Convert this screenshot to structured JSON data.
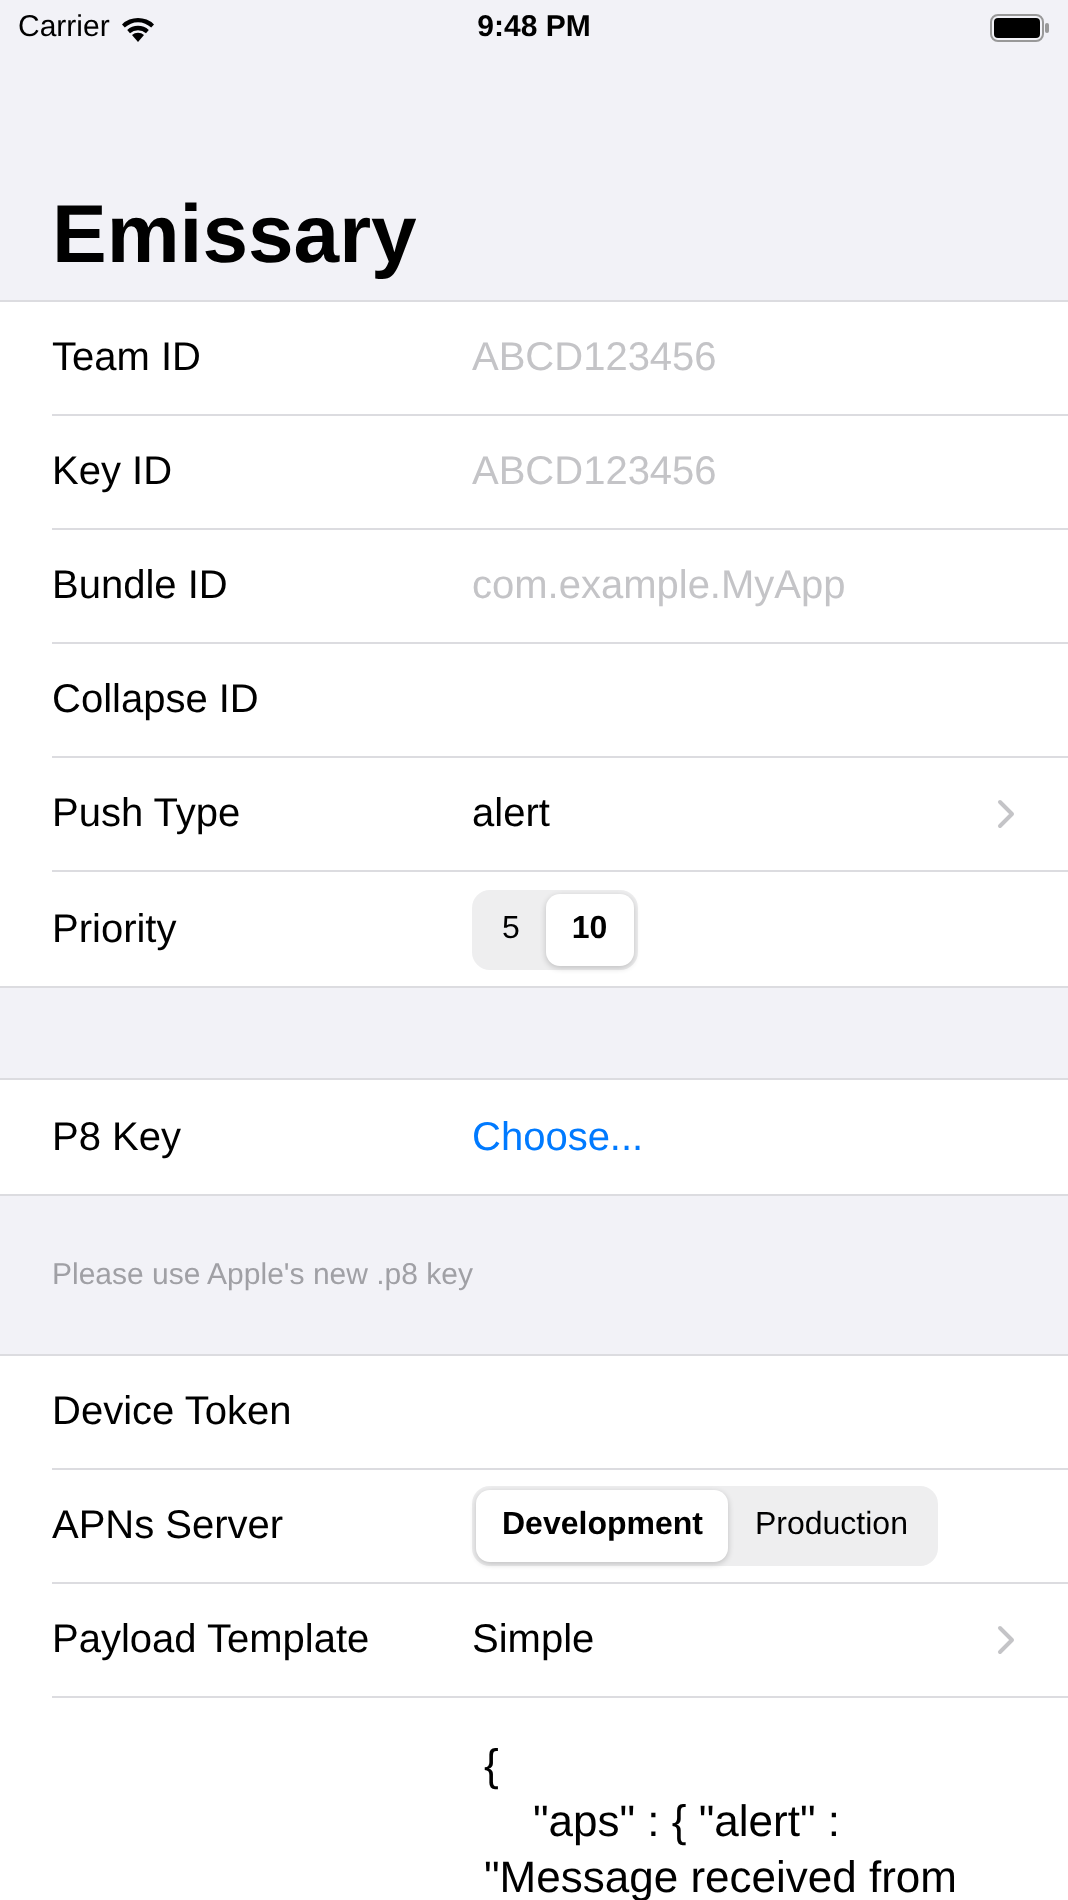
{
  "status_bar": {
    "carrier": "Carrier",
    "time": "9:48 PM"
  },
  "title": "Emissary",
  "sections": [
    {
      "rows": [
        {
          "kind": "field",
          "label": "Team ID",
          "placeholder": "ABCD123456"
        },
        {
          "kind": "field",
          "label": "Key ID",
          "placeholder": "ABCD123456"
        },
        {
          "kind": "field",
          "label": "Bundle ID",
          "placeholder": "com.example.MyApp"
        },
        {
          "kind": "field",
          "label": "Collapse ID"
        },
        {
          "kind": "disclosure",
          "label": "Push Type",
          "value": "alert"
        },
        {
          "kind": "segmented",
          "label": "Priority",
          "segments": [
            {
              "label": "5",
              "selected": false
            },
            {
              "label": "10",
              "selected": true
            }
          ]
        }
      ]
    },
    {
      "rows": [
        {
          "kind": "link",
          "label": "P8 Key",
          "value": "Choose..."
        }
      ],
      "footer": "Please use Apple's new .p8 key"
    },
    {
      "rows": [
        {
          "kind": "field",
          "label": "Device Token"
        },
        {
          "kind": "segmented",
          "label": "APNs Server",
          "segments": [
            {
              "label": "Development",
              "selected": true
            },
            {
              "label": "Production",
              "selected": false
            }
          ]
        },
        {
          "kind": "disclosure",
          "label": "Payload Template",
          "value": "Simple"
        },
        {
          "kind": "payload",
          "lines": [
            "{",
            "    \"aps\" : { \"alert\" :",
            "\"Message received from"
          ]
        }
      ]
    }
  ]
}
